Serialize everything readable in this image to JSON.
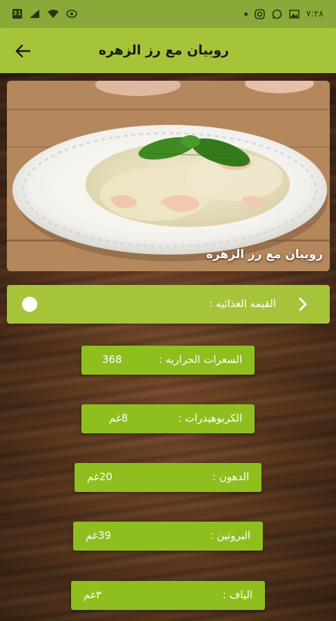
{
  "status_bar": {
    "time": "٧:٢٨",
    "sim_badge": "31"
  },
  "app_bar": {
    "title": "روبيان مع رز الزهره",
    "back_icon": "arrow-left-icon"
  },
  "hero": {
    "caption": "روبيان مع رز الزهره"
  },
  "nutrition": {
    "header_label": "القيمه الغذائيه :",
    "items": [
      {
        "label": "السعرات الحراريه :",
        "value": "368"
      },
      {
        "label": "الكربوهيدرات :",
        "value": "8غم"
      },
      {
        "label": "الدهون :",
        "value": "20غم"
      },
      {
        "label": "البروتين :",
        "value": "39غم"
      },
      {
        "label": "الياف :",
        "value": "٣غم"
      }
    ]
  },
  "colors": {
    "status_bar": "#8aa938",
    "app_bar": "#a6c43a",
    "pill": "#8ebf1e"
  }
}
